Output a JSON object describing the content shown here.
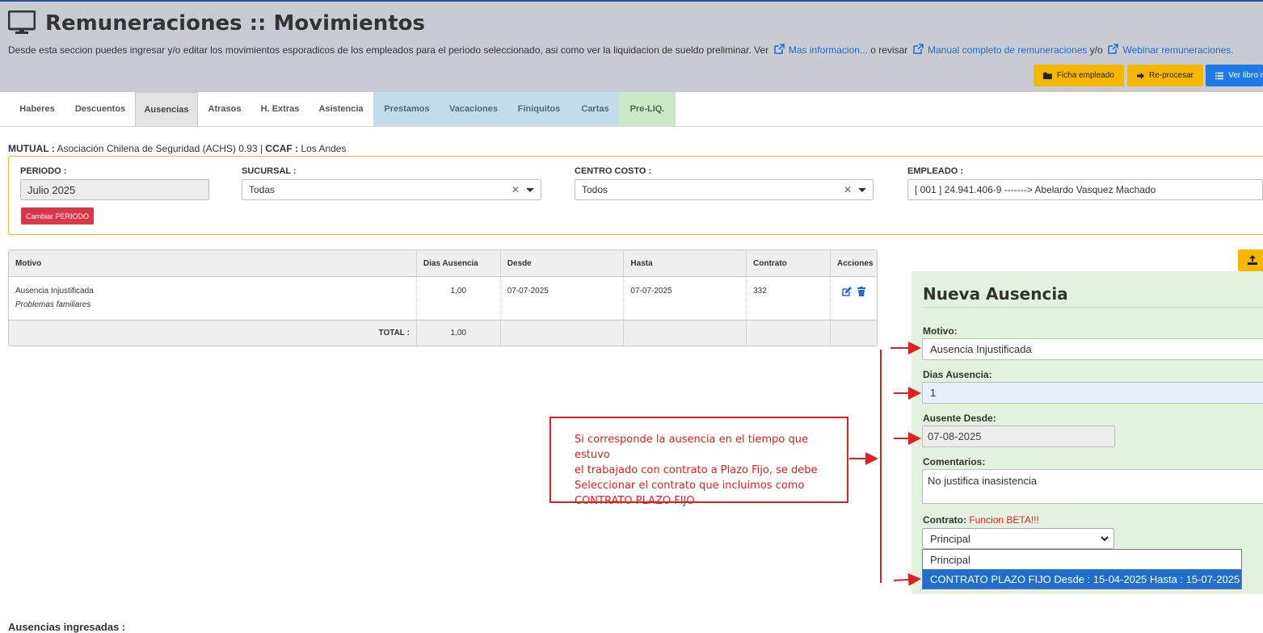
{
  "header": {
    "title": "Remuneraciones :: Movimientos",
    "description": "Desde esta seccion puedes ingresar y/o editar los movimientos esporadicos de los empleados para el periodo seleccionado, asi como ver la liquidacion de sueldo preliminar. Ver",
    "link1": "Mas informacion...",
    "sep1": "o revisar",
    "link2": "Manual completo de remuneraciones",
    "sep2": "y/o",
    "link3": "Webinar remuneraciones.",
    "buttons": {
      "ficha": "Ficha empleado",
      "reprocesar": "Re-procesar",
      "libro": "Ver libro r"
    }
  },
  "tabs": [
    "Haberes",
    "Descuentos",
    "Ausencias",
    "Atrasos",
    "H. Extras",
    "Asistencia",
    "Prestamos",
    "Vacaciones",
    "Finiquitos",
    "Cartas",
    "Pre-LIQ."
  ],
  "mutual": {
    "mutual_label": "MUTUAL :",
    "mutual_value": "Asociación Chilena de Seguridad (ACHS) 0.93",
    "sep": "|",
    "ccaf_label": "CCAF :",
    "ccaf_value": "Los Andes"
  },
  "filters": {
    "periodo_label": "PERIODO :",
    "periodo_value": "Julio 2025",
    "cambiar_button": "Cambiar PERIODO",
    "sucursal_label": "SUCURSAL :",
    "sucursal_value": "Todas",
    "centro_label": "CENTRO COSTO :",
    "centro_value": "Todos",
    "empleado_label": "EMPLEADO :",
    "empleado_value": "[ 001 ] 24.941.406-9 -------> Abelardo Vasquez Machado"
  },
  "table": {
    "headers": [
      "Motivo",
      "Dias Ausencia",
      "Desde",
      "Hasta",
      "Contrato",
      "Acciones"
    ],
    "rows": [
      {
        "motivo": "Ausencia Injustificada",
        "comentario": "Problemas familiares",
        "dias": "1,00",
        "desde": "07-07-2025",
        "hasta": "07-07-2025",
        "contrato": "332"
      }
    ],
    "total_label": "TOTAL :",
    "total_value": "1,00"
  },
  "form": {
    "title": "Nueva Ausencia",
    "motivo_label": "Motivo:",
    "motivo_value": "Ausencia Injustificada",
    "dias_label": "Dias Ausencia:",
    "dias_value": "1",
    "desde_label": "Ausente Desde:",
    "desde_value": "07-08-2025",
    "comentarios_label": "Comentarios:",
    "comentarios_value": "No justifica inasistencia",
    "contrato_label": "Contrato:",
    "contrato_beta": "Funcion BETA!!!",
    "contrato_selected": "Principal",
    "contrato_options": [
      "Principal",
      "CONTRATO PLAZO FIJO Desde : 15-04-2025 Hasta : 15-07-2025"
    ]
  },
  "callout": {
    "lines": [
      "Si corresponde la ausencia en el tiempo que estuvo",
      "el trabajado con contrato a Plazo Fijo, se debe",
      "Seleccionar el contrato que incluimos como",
      "CONTRATO PLAZO FIJO"
    ]
  },
  "bottom": {
    "heading": "Ausencias ingresadas :"
  },
  "colors": {
    "header_bg": "#c8cbd2",
    "accent_yellow": "#f6b701",
    "accent_blue": "#1e7ae6",
    "danger": "#dc3545",
    "annotation_red": "#e02020",
    "form_bg": "#e3f2de"
  }
}
